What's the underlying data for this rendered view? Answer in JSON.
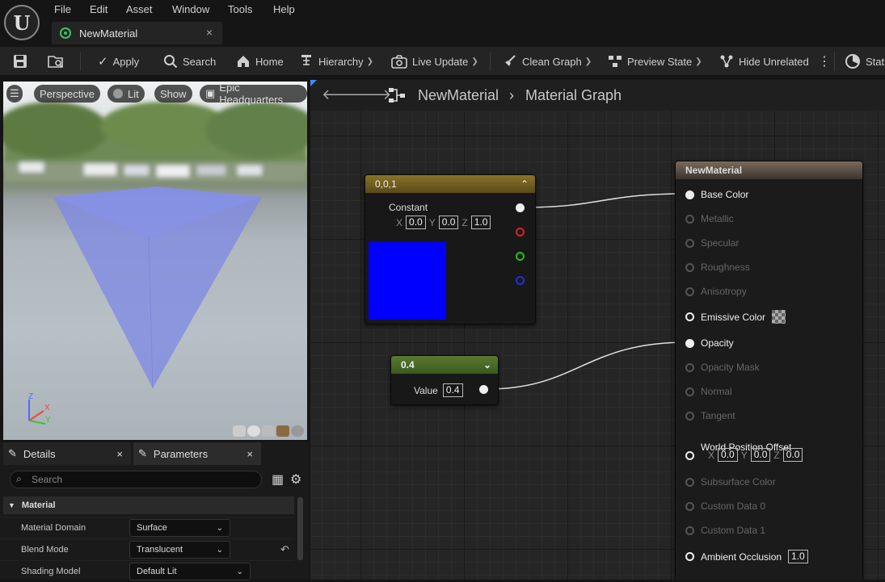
{
  "menu": [
    "File",
    "Edit",
    "Asset",
    "Window",
    "Tools",
    "Help"
  ],
  "tab": {
    "title": "NewMaterial",
    "close": "×"
  },
  "toolbar": {
    "apply": "Apply",
    "search": "Search",
    "home": "Home",
    "hierarchy": "Hierarchy",
    "live_update": "Live Update",
    "clean_graph": "Clean Graph",
    "preview_state": "Preview State",
    "hide_unrelated": "Hide Unrelated",
    "stats": "Stats"
  },
  "viewport": {
    "perspective": "Perspective",
    "lit": "Lit",
    "show": "Show",
    "location": "Epic Headquarters"
  },
  "panel": {
    "details_tab": "Details",
    "params_tab": "Parameters",
    "close": "×",
    "search_placeholder": "Search",
    "section": "Material",
    "rows": [
      {
        "label": "Material Domain",
        "value": "Surface"
      },
      {
        "label": "Blend Mode",
        "value": "Translucent"
      },
      {
        "label": "Shading Model",
        "value": "Default Lit"
      }
    ]
  },
  "breadcrumb": {
    "asset": "NewMaterial",
    "graph": "Material Graph"
  },
  "const_node": {
    "title": "0,0,1",
    "label": "Constant",
    "x": "0.0",
    "y": "0.0",
    "z": "1.0",
    "preview_color": "#0000ff"
  },
  "value_node": {
    "title": "0.4",
    "label": "Value",
    "value": "0.4"
  },
  "material_node": {
    "title": "NewMaterial",
    "pins": [
      {
        "name": "Base Color",
        "active": true
      },
      {
        "name": "Metallic",
        "active": false
      },
      {
        "name": "Specular",
        "active": false
      },
      {
        "name": "Roughness",
        "active": false
      },
      {
        "name": "Anisotropy",
        "active": false
      },
      {
        "name": "Emissive Color",
        "active": true
      },
      {
        "name": "Opacity",
        "active": true
      },
      {
        "name": "Opacity Mask",
        "active": false
      },
      {
        "name": "Normal",
        "active": false
      },
      {
        "name": "Tangent",
        "active": false
      },
      {
        "name": "World Position Offset",
        "active": true
      },
      {
        "name": "Subsurface Color",
        "active": false
      },
      {
        "name": "Custom Data 0",
        "active": false
      },
      {
        "name": "Custom Data 1",
        "active": false
      },
      {
        "name": "Ambient Occlusion",
        "active": true
      }
    ],
    "wpo": {
      "x": "0.0",
      "y": "0.0",
      "z": "0.0"
    },
    "ao_value": "1.0"
  },
  "axis_labels": {
    "x": "X",
    "y": "Y",
    "z": "Z"
  }
}
